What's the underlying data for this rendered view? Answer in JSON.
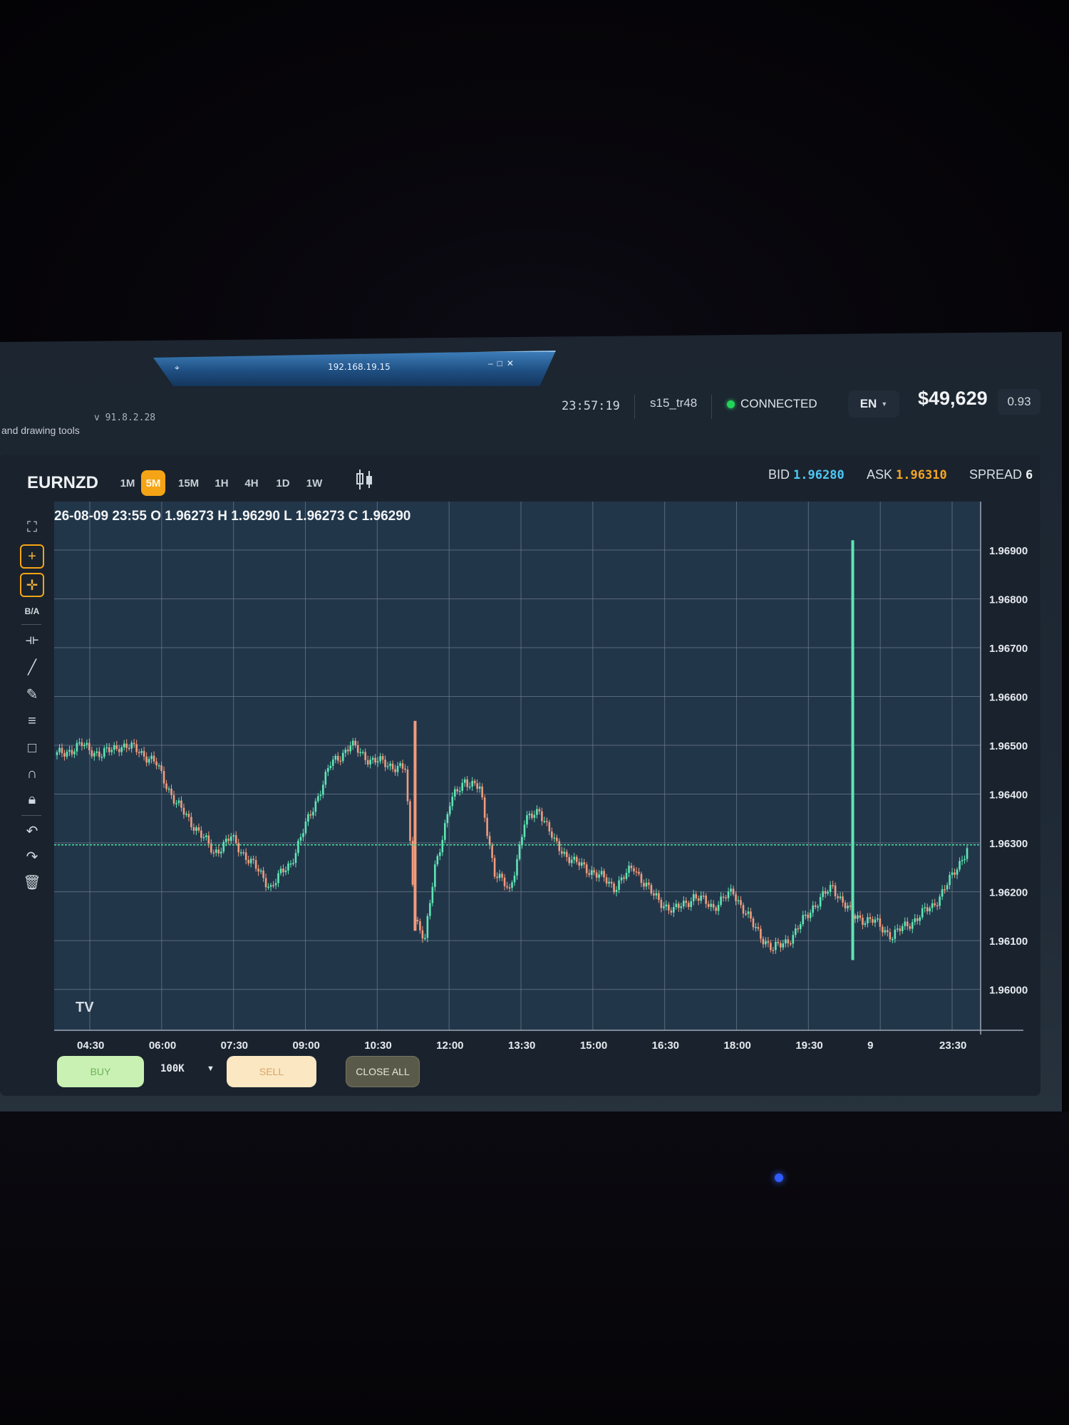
{
  "window": {
    "remote_ip": "192.168.19.15",
    "version": "v 91.8.2.28",
    "hint": "and drawing tools"
  },
  "status": {
    "clock": "23:57:19",
    "user": "s15_tr48",
    "connection": "CONNECTED",
    "language": "EN",
    "balance": "$49,629",
    "ratio": "0.93"
  },
  "symbol": "EURNZD",
  "timeframes": [
    "1M",
    "5M",
    "15M",
    "1H",
    "4H",
    "1D",
    "1W"
  ],
  "active_timeframe": "5M",
  "quote": {
    "bid_label": "BID",
    "bid": "1.96280",
    "ask_label": "ASK",
    "ask": "1.96310",
    "spread_label": "SPREAD",
    "spread": "6"
  },
  "tools": {
    "ba_label": "B/A"
  },
  "chart_data": {
    "type": "candlestick",
    "ohlc_label": "26-08-09 23:55 O 1.96273 H 1.96290 L 1.96273 C 1.96290",
    "price_ticks": [
      "1.96900",
      "1.96800",
      "1.96700",
      "1.96600",
      "1.96500",
      "1.96400",
      "1.96300",
      "1.96200",
      "1.96100",
      "1.96000"
    ],
    "ylim": [
      1.9596,
      1.9697
    ],
    "time_ticks": [
      "04:30",
      "06:00",
      "07:30",
      "09:00",
      "10:30",
      "12:00",
      "13:30",
      "15:00",
      "16:30",
      "18:00",
      "19:30",
      "9",
      "23:30"
    ],
    "current_price": 1.96296,
    "close_path": [
      [
        0,
        1.9648
      ],
      [
        10,
        1.965
      ],
      [
        18,
        1.9648
      ],
      [
        25,
        1.965
      ],
      [
        33,
        1.9649
      ],
      [
        40,
        1.9646
      ],
      [
        48,
        1.9638
      ],
      [
        56,
        1.9633
      ],
      [
        63,
        1.9628
      ],
      [
        70,
        1.9631
      ],
      [
        78,
        1.9626
      ],
      [
        86,
        1.9621
      ],
      [
        94,
        1.9626
      ],
      [
        102,
        1.9636
      ],
      [
        110,
        1.9646
      ],
      [
        118,
        1.965
      ],
      [
        126,
        1.9647
      ],
      [
        134,
        1.9646
      ],
      [
        140,
        1.9645
      ],
      [
        144,
        1.9615
      ],
      [
        148,
        1.961
      ],
      [
        152,
        1.9625
      ],
      [
        158,
        1.9638
      ],
      [
        164,
        1.9643
      ],
      [
        170,
        1.9641
      ],
      [
        176,
        1.9624
      ],
      [
        182,
        1.962
      ],
      [
        188,
        1.9634
      ],
      [
        194,
        1.9637
      ],
      [
        200,
        1.963
      ],
      [
        208,
        1.9626
      ],
      [
        216,
        1.9624
      ],
      [
        224,
        1.9621
      ],
      [
        232,
        1.9625
      ],
      [
        240,
        1.9619
      ],
      [
        248,
        1.9616
      ],
      [
        256,
        1.9619
      ],
      [
        264,
        1.9617
      ],
      [
        272,
        1.962
      ],
      [
        280,
        1.9613
      ],
      [
        288,
        1.9608
      ],
      [
        296,
        1.9611
      ],
      [
        304,
        1.9617
      ],
      [
        312,
        1.9621
      ],
      [
        320,
        1.9615
      ],
      [
        328,
        1.9614
      ],
      [
        336,
        1.9611
      ],
      [
        344,
        1.9614
      ],
      [
        352,
        1.9617
      ],
      [
        360,
        1.9623
      ],
      [
        366,
        1.9629
      ]
    ],
    "spikes": [
      {
        "t": 144,
        "high": 1.9655,
        "low": 1.9612,
        "color": "down"
      },
      {
        "t": 320,
        "high": 1.9692,
        "low": 1.9606,
        "color": "up"
      }
    ]
  },
  "order": {
    "buy_label": "BUY",
    "size": "100K",
    "sell_label": "SELL",
    "close_all_label": "CLOSE ALL"
  },
  "colors": {
    "up": "#5fe6b5",
    "down": "#f29b7c",
    "accent": "#f5a416",
    "bid": "#4fc8f5",
    "ask": "#f6a623"
  }
}
